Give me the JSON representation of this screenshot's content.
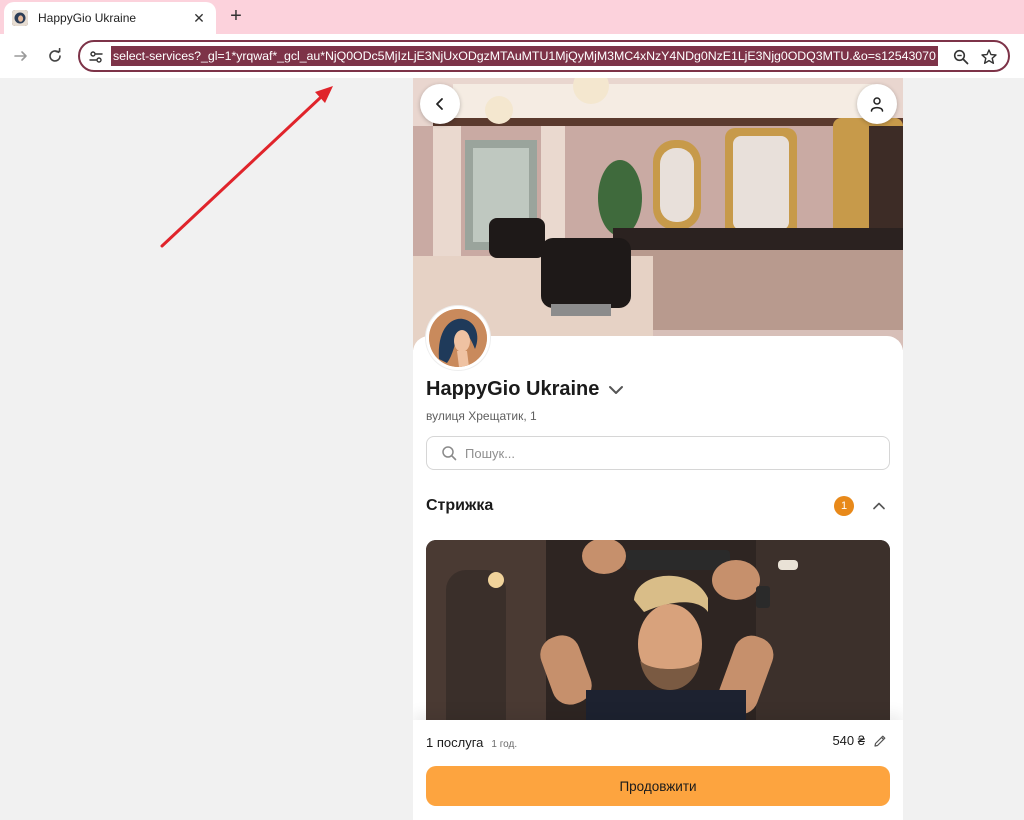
{
  "browser": {
    "tab_title": "HappyGio Ukraine",
    "url": "select-services?_gl=1*yrqwaf*_gcl_au*NjQ0ODc5MjIzLjE3NjUxODgzMTAuMTU1MjQyMjM3MC4xNzY4NDg0NzE1LjE3Njg0ODQ3MTU.&o=s12543070",
    "icons": [
      "forward-icon",
      "reload-icon",
      "site-info-icon",
      "zoom-icon",
      "bookmark-star-icon",
      "close-icon",
      "plus-icon"
    ]
  },
  "salon": {
    "name": "HappyGio Ukraine",
    "address": "вулиця Хрещатик, 1"
  },
  "search": {
    "placeholder": "Пошук..."
  },
  "category": {
    "title": "Стрижка",
    "selected_count": "1"
  },
  "summary": {
    "services_count": "1 послуга",
    "duration": "1 год.",
    "price": "540 ₴",
    "continue_label": "Продовжити"
  },
  "colors": {
    "tab_strip": "#fcd2dc",
    "omnibox_border": "#7d3348",
    "accent_button": "#fda43f",
    "badge": "#e8891a",
    "annotation_arrow": "#e0242b"
  }
}
